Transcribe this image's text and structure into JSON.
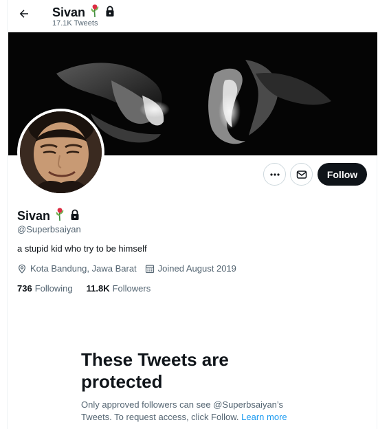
{
  "header": {
    "name": "Sivan",
    "tweet_count": "17.1K Tweets"
  },
  "profile": {
    "name": "Sivan",
    "handle": "@Superbsaiyan",
    "bio": "a stupid kid who try to be himself",
    "location": "Kota Bandung, Jawa Barat",
    "joined": "Joined August 2019",
    "following_count": "736",
    "following_label": "Following",
    "followers_count": "11.8K",
    "followers_label": "Followers"
  },
  "actions": {
    "more_icon": "more-horizontal-icon",
    "message_icon": "envelope-icon",
    "follow_label": "Follow"
  },
  "protected_notice": {
    "title": "These Tweets are protected",
    "body": "Only approved followers can see @Superbsaiyan’s Tweets. To request access, click Follow.",
    "learn_more": "Learn more"
  },
  "colors": {
    "text_primary": "#0f1419",
    "text_secondary": "#536471",
    "link": "#1d9bf0",
    "follow_button": "#0f1419",
    "border": "#cfd9de"
  }
}
